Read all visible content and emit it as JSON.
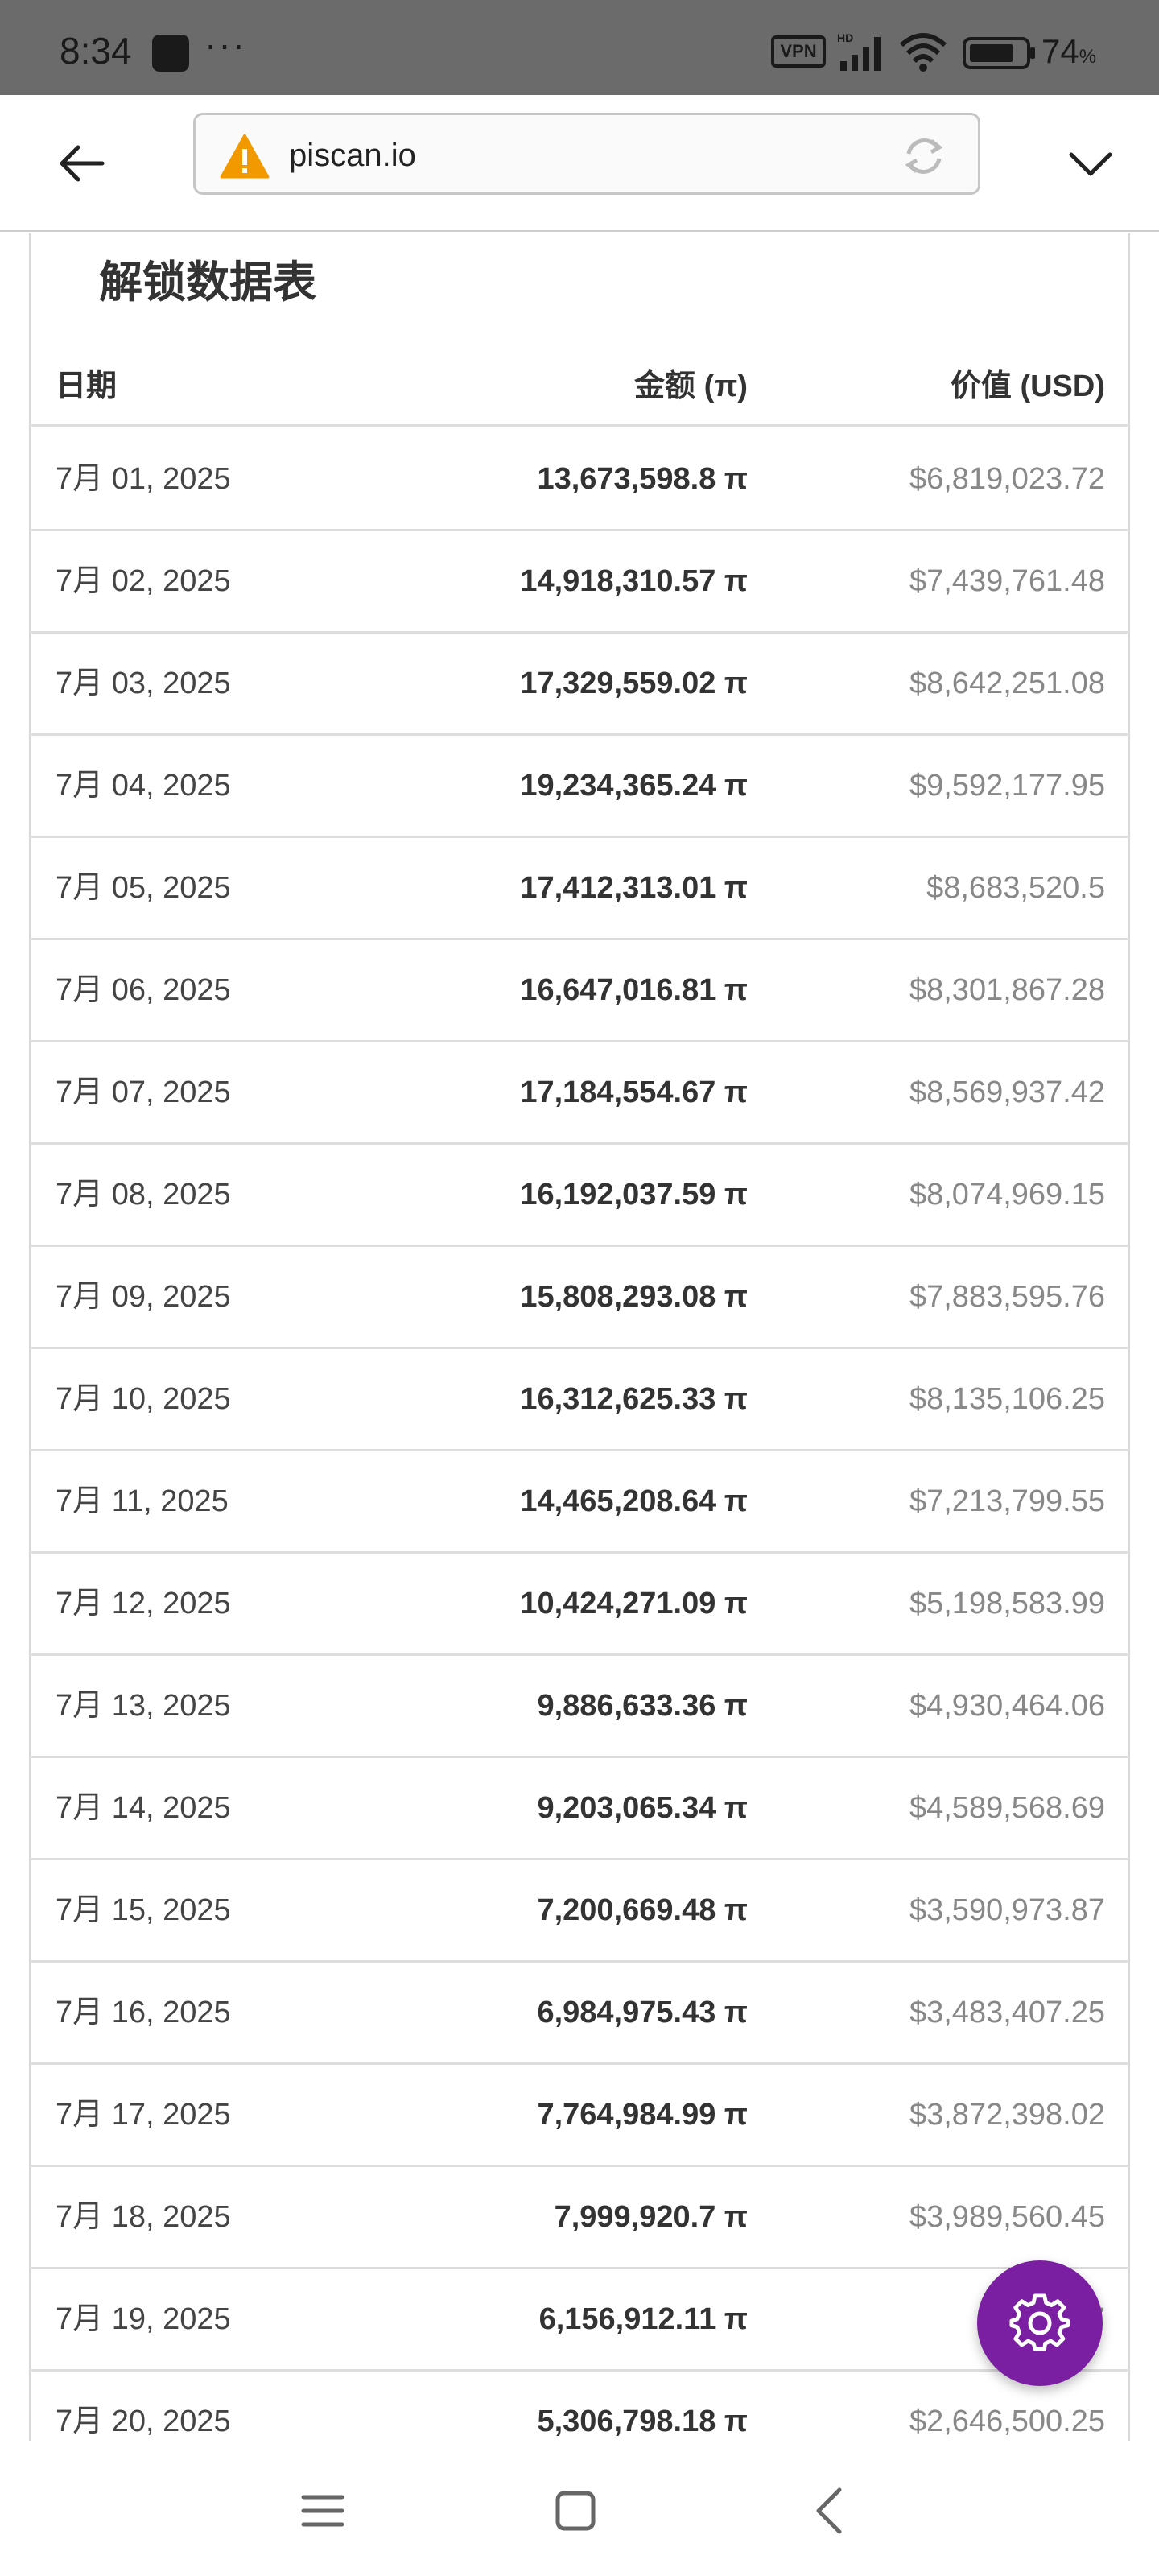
{
  "status_bar": {
    "time": "8:34",
    "dots": "···",
    "vpn": "VPN",
    "battery_percent": "74",
    "battery_unit": "%"
  },
  "browser": {
    "url": "piscan.io",
    "security_state": "warning",
    "icons": [
      "back-arrow-icon",
      "warning-icon",
      "reload-icon",
      "chevron-down-icon"
    ]
  },
  "table": {
    "title": "解锁数据表",
    "headers": {
      "date": "日期",
      "amount": "金额 (π)",
      "value": "价值 (USD)"
    },
    "rows": [
      {
        "date": "7月 01, 2025",
        "amount": "13,673,598.8 π",
        "value": "$6,819,023.72"
      },
      {
        "date": "7月 02, 2025",
        "amount": "14,918,310.57 π",
        "value": "$7,439,761.48"
      },
      {
        "date": "7月 03, 2025",
        "amount": "17,329,559.02 π",
        "value": "$8,642,251.08"
      },
      {
        "date": "7月 04, 2025",
        "amount": "19,234,365.24 π",
        "value": "$9,592,177.95"
      },
      {
        "date": "7月 05, 2025",
        "amount": "17,412,313.01 π",
        "value": "$8,683,520.5"
      },
      {
        "date": "7月 06, 2025",
        "amount": "16,647,016.81 π",
        "value": "$8,301,867.28"
      },
      {
        "date": "7月 07, 2025",
        "amount": "17,184,554.67 π",
        "value": "$8,569,937.42"
      },
      {
        "date": "7月 08, 2025",
        "amount": "16,192,037.59 π",
        "value": "$8,074,969.15"
      },
      {
        "date": "7月 09, 2025",
        "amount": "15,808,293.08 π",
        "value": "$7,883,595.76"
      },
      {
        "date": "7月 10, 2025",
        "amount": "16,312,625.33 π",
        "value": "$8,135,106.25"
      },
      {
        "date": "7月 11, 2025",
        "amount": "14,465,208.64 π",
        "value": "$7,213,799.55"
      },
      {
        "date": "7月 12, 2025",
        "amount": "10,424,271.09 π",
        "value": "$5,198,583.99"
      },
      {
        "date": "7月 13, 2025",
        "amount": "9,886,633.36 π",
        "value": "$4,930,464.06"
      },
      {
        "date": "7月 14, 2025",
        "amount": "9,203,065.34 π",
        "value": "$4,589,568.69"
      },
      {
        "date": "7月 15, 2025",
        "amount": "7,200,669.48 π",
        "value": "$3,590,973.87"
      },
      {
        "date": "7月 16, 2025",
        "amount": "6,984,975.43 π",
        "value": "$3,483,407.25"
      },
      {
        "date": "7月 17, 2025",
        "amount": "7,764,984.99 π",
        "value": "$3,872,398.02"
      },
      {
        "date": "7月 18, 2025",
        "amount": "7,999,920.7 π",
        "value": "$3,989,560.45"
      },
      {
        "date": "7月 19, 2025",
        "amount": "6,156,912.11 π",
        "value": "$3,07"
      },
      {
        "date": "7月 20, 2025",
        "amount": "5,306,798.18 π",
        "value": "$2,646,500.25"
      }
    ]
  },
  "fab": {
    "icon": "settings-gear-icon",
    "color": "#7b1fa2"
  },
  "nav_bar": {
    "icons": [
      "menu-icon",
      "home-square-icon",
      "back-chevron-icon"
    ]
  }
}
